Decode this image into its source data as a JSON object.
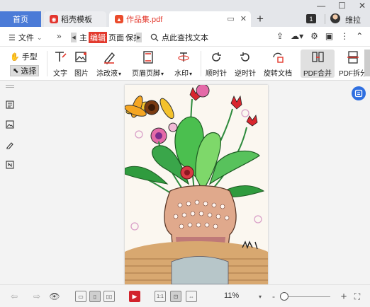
{
  "titlebar": {
    "home_tab": "首页",
    "tabs": [
      {
        "label": "稻壳模板"
      },
      {
        "label": "作品集.pdf"
      }
    ],
    "new_tab_symbol": "+",
    "badge_count": "1",
    "user_name": "维拉",
    "window_controls": [
      "—",
      "☐",
      "✕"
    ]
  },
  "menubar": {
    "file_label": "文件",
    "more_symbol": "»",
    "ribbon_tabs": [
      "主",
      "编辑",
      "页面",
      "保护"
    ],
    "active_tab": "编辑",
    "search_label": "点此查找文本",
    "right_icons": [
      "share-icon",
      "cloud-icon",
      "settings-icon",
      "comment-icon",
      "more-icon",
      "collapse-icon"
    ]
  },
  "toolbar": {
    "hand_label": "手型",
    "select_label": "选择",
    "tools": [
      {
        "label": "文字",
        "icon": "text-edit-icon"
      },
      {
        "label": "图片",
        "icon": "image-edit-icon"
      },
      {
        "label": "涂改液",
        "icon": "correction-pen-icon",
        "dropdown": true
      },
      {
        "label": "页眉页脚",
        "icon": "header-footer-icon",
        "dropdown": true
      },
      {
        "label": "水印",
        "icon": "watermark-icon",
        "dropdown": true
      },
      {
        "label": "顺时针",
        "icon": "rotate-cw-icon"
      },
      {
        "label": "逆时针",
        "icon": "rotate-ccw-icon"
      },
      {
        "label": "旋转文档",
        "icon": "rotate-doc-icon"
      },
      {
        "label": "PDF合并",
        "icon": "pdf-merge-icon",
        "active": true
      },
      {
        "label": "PDF拆分",
        "icon": "pdf-split-icon"
      }
    ]
  },
  "leftpanel": {
    "icons": [
      "bookmark-icon",
      "image-panel-icon",
      "signature-icon",
      "attachment-icon"
    ]
  },
  "statusbar": {
    "zoom": "11%",
    "zoom_percent": 11,
    "minus": "-",
    "plus": "+"
  },
  "colors": {
    "accent_blue": "#4b7bd7",
    "brand_red": "#e33a2e",
    "float_button": "#2f6fe0"
  }
}
